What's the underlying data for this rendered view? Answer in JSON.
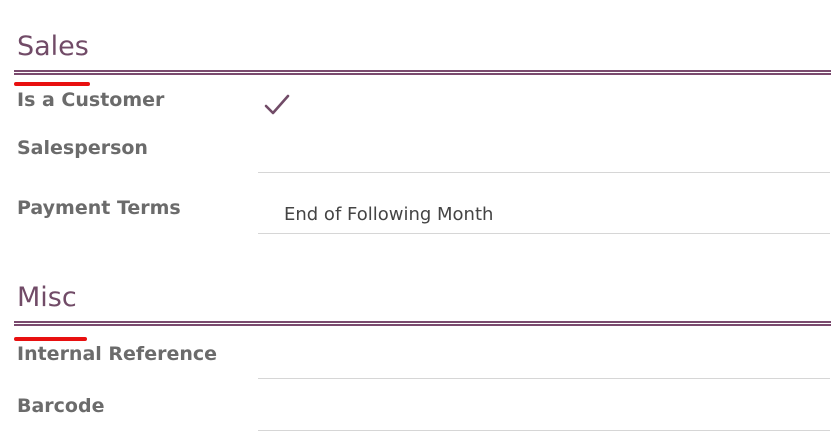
{
  "sales": {
    "title": "Sales",
    "fields": {
      "is_customer": {
        "label": "Is a Customer",
        "checked": true
      },
      "salesperson": {
        "label": "Salesperson",
        "value": ""
      },
      "payment_terms": {
        "label": "Payment Terms",
        "value": "End of Following Month"
      }
    }
  },
  "misc": {
    "title": "Misc",
    "fields": {
      "internal_reference": {
        "label": "Internal Reference",
        "value": ""
      },
      "barcode": {
        "label": "Barcode",
        "value": ""
      }
    }
  },
  "colors": {
    "accent": "#714B67",
    "annotation": "#E81010",
    "label": "#6B6B6B",
    "divider": "#D6D6D6"
  }
}
